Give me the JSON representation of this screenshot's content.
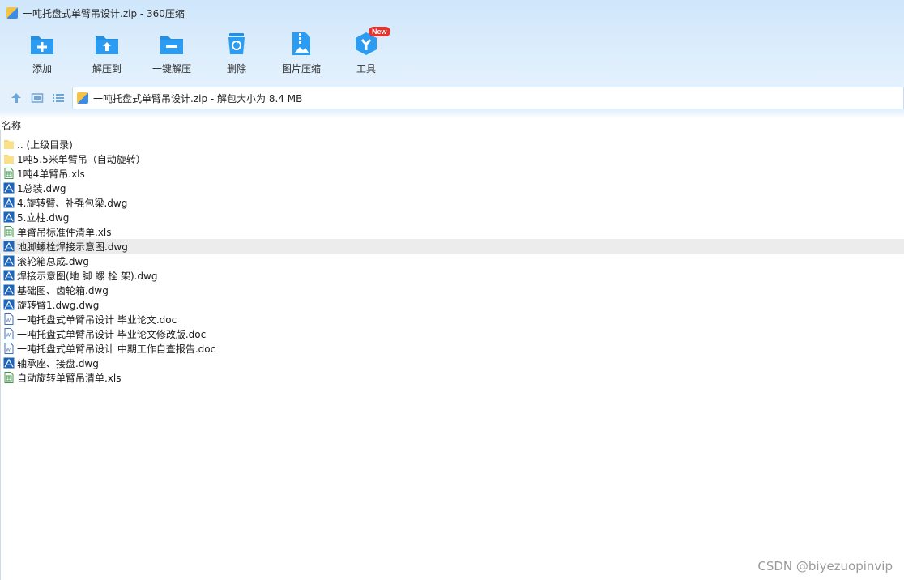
{
  "window": {
    "title": "一吨托盘式单臂吊设计.zip - 360压缩"
  },
  "toolbar": {
    "buttons": [
      {
        "label": "添加",
        "icon": "add-icon"
      },
      {
        "label": "解压到",
        "icon": "extract-to-icon"
      },
      {
        "label": "一键解压",
        "icon": "one-click-extract-icon"
      },
      {
        "label": "删除",
        "icon": "delete-icon"
      },
      {
        "label": "图片压缩",
        "icon": "image-compress-icon"
      },
      {
        "label": "工具",
        "icon": "tools-icon"
      }
    ],
    "new_badge": "New"
  },
  "address_bar": {
    "text": "一吨托盘式单臂吊设计.zip - 解包大小为 8.4 MB"
  },
  "list": {
    "column_header": "名称",
    "items": [
      {
        "name": ".. (上级目录)",
        "type": "folder"
      },
      {
        "name": "1吨5.5米单臂吊（自动旋转）",
        "type": "folder"
      },
      {
        "name": "1吨4单臂吊.xls",
        "type": "xls"
      },
      {
        "name": "1总装.dwg",
        "type": "dwg"
      },
      {
        "name": "4.旋转臂、补强包梁.dwg",
        "type": "dwg"
      },
      {
        "name": "5.立柱.dwg",
        "type": "dwg"
      },
      {
        "name": "单臂吊标准件清单.xls",
        "type": "xls"
      },
      {
        "name": "地脚螺栓焊接示意图.dwg",
        "type": "dwg",
        "selected": true
      },
      {
        "name": "滚轮箱总成.dwg",
        "type": "dwg"
      },
      {
        "name": "焊接示意图(地 脚 螺 栓 架).dwg",
        "type": "dwg"
      },
      {
        "name": "基础图、齿轮箱.dwg",
        "type": "dwg"
      },
      {
        "name": "旋转臂1.dwg.dwg",
        "type": "dwg"
      },
      {
        "name": "一吨托盘式单臂吊设计 毕业论文.doc",
        "type": "doc"
      },
      {
        "name": "一吨托盘式单臂吊设计 毕业论文修改版.doc",
        "type": "doc"
      },
      {
        "name": "一吨托盘式单臂吊设计 中期工作自查报告.doc",
        "type": "doc"
      },
      {
        "name": "轴承座、接盘.dwg",
        "type": "dwg"
      },
      {
        "name": "自动旋转单臂吊清单.xls",
        "type": "xls"
      }
    ]
  },
  "watermark": "CSDN @biyezuopinvip"
}
